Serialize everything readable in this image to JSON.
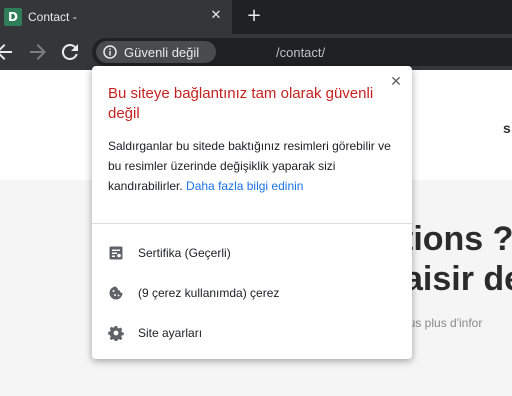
{
  "tab": {
    "favicon_letter": "D",
    "title": "Contact -",
    "close_glyph": "✕",
    "new_tab_glyph": "+"
  },
  "toolbar": {
    "security_chip_label": "Güvenli değil",
    "url_path": "/contact/"
  },
  "page": {
    "header_fragment": "s",
    "hero_line1": "tions ?",
    "hero_line2": "aisir de",
    "hero_sub": "ous plus d'infor"
  },
  "popup": {
    "close_glyph": "✕",
    "title": "Bu siteye bağlantınız tam olarak güvenli değil",
    "description": "Saldırganlar bu sitede baktığınız resimleri görebilir ve bu resimler üzerinde değişiklik yaparak sizi kandırabilirler.",
    "learn_more": "Daha fazla bilgi edinin",
    "rows": [
      {
        "label": "Sertifika (Geçerli)",
        "icon": "certificate-icon"
      },
      {
        "label": "(9 çerez kullanımda) çerez",
        "icon": "cookie-icon"
      },
      {
        "label": "Site ayarları",
        "icon": "gear-icon"
      }
    ]
  },
  "colors": {
    "tabstrip_bg": "#202124",
    "toolbar_bg": "#35363a",
    "warning_red": "#c5221f",
    "link_blue": "#1a73e8"
  }
}
